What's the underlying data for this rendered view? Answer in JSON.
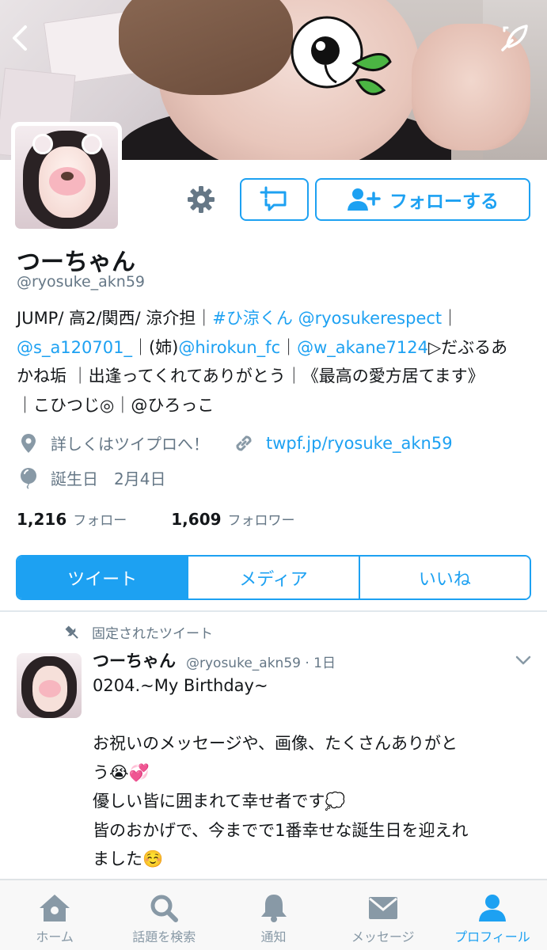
{
  "header": {
    "back_icon": "chevron-left-icon",
    "edit_icon": "quill-icon"
  },
  "actions": {
    "settings_icon": "gear-icon",
    "lists_icon": "add-to-list-icon",
    "follow_label": "フォローする"
  },
  "profile": {
    "name": "つーちゃん",
    "handle": "@ryosuke_akn59",
    "bio_lines": [
      [
        {
          "t": "JUMP/ 高2/関西/ 涼介担｜",
          "link": false
        },
        {
          "t": "#ひ涼くん",
          "link": true
        },
        {
          "t": " ",
          "link": false
        },
        {
          "t": "@ryosukerespect",
          "link": true
        },
        {
          "t": "｜",
          "link": false
        }
      ],
      [
        {
          "t": "@s_a120701_",
          "link": true
        },
        {
          "t": "｜(姉)",
          "link": false
        },
        {
          "t": "@hirokun_fc",
          "link": true
        },
        {
          "t": "｜",
          "link": false
        },
        {
          "t": "@w_akane7124",
          "link": true
        },
        {
          "t": "▷だぶるあ",
          "link": false
        }
      ],
      [
        {
          "t": "かね垢 ｜出逢ってくれてありがとう｜《最高の愛方居てます》",
          "link": false
        }
      ],
      [
        {
          "t": "｜こひつじ◎｜@ひろっこ",
          "link": false
        }
      ]
    ],
    "location": "詳しくはツイプロへ！",
    "website": "twpf.jp/ryosuke_akn59",
    "birthday": "誕生日　2月4日",
    "following_count": "1,216",
    "following_label": "フォロー",
    "followers_count": "1,609",
    "followers_label": "フォロワー"
  },
  "tabs": [
    {
      "label": "ツイート",
      "active": true
    },
    {
      "label": "メディア",
      "active": false
    },
    {
      "label": "いいね",
      "active": false
    }
  ],
  "pinned_tweet": {
    "pinned_label": "固定されたツイート",
    "author_name": "つーちゃん",
    "author_meta": "@ryosuke_akn59 · 1日",
    "lines": [
      "0204.~My Birthday~",
      "",
      "お祝いのメッセージや、画像、たくさんありがと",
      "う😭💞",
      "優しい皆に囲まれて幸せ者です💭",
      "皆のおかげで、今までで1番幸せな誕生日を迎えれ",
      "ました☺️"
    ]
  },
  "tabbar": [
    {
      "label": "ホーム",
      "icon": "home-icon",
      "active": false
    },
    {
      "label": "話題を検索",
      "icon": "search-icon",
      "active": false
    },
    {
      "label": "通知",
      "icon": "bell-icon",
      "active": false
    },
    {
      "label": "メッセージ",
      "icon": "mail-icon",
      "active": false
    },
    {
      "label": "プロフィール",
      "icon": "person-icon",
      "active": true
    }
  ],
  "colors": {
    "accent": "#1da1f2",
    "secondary_text": "#657786"
  }
}
